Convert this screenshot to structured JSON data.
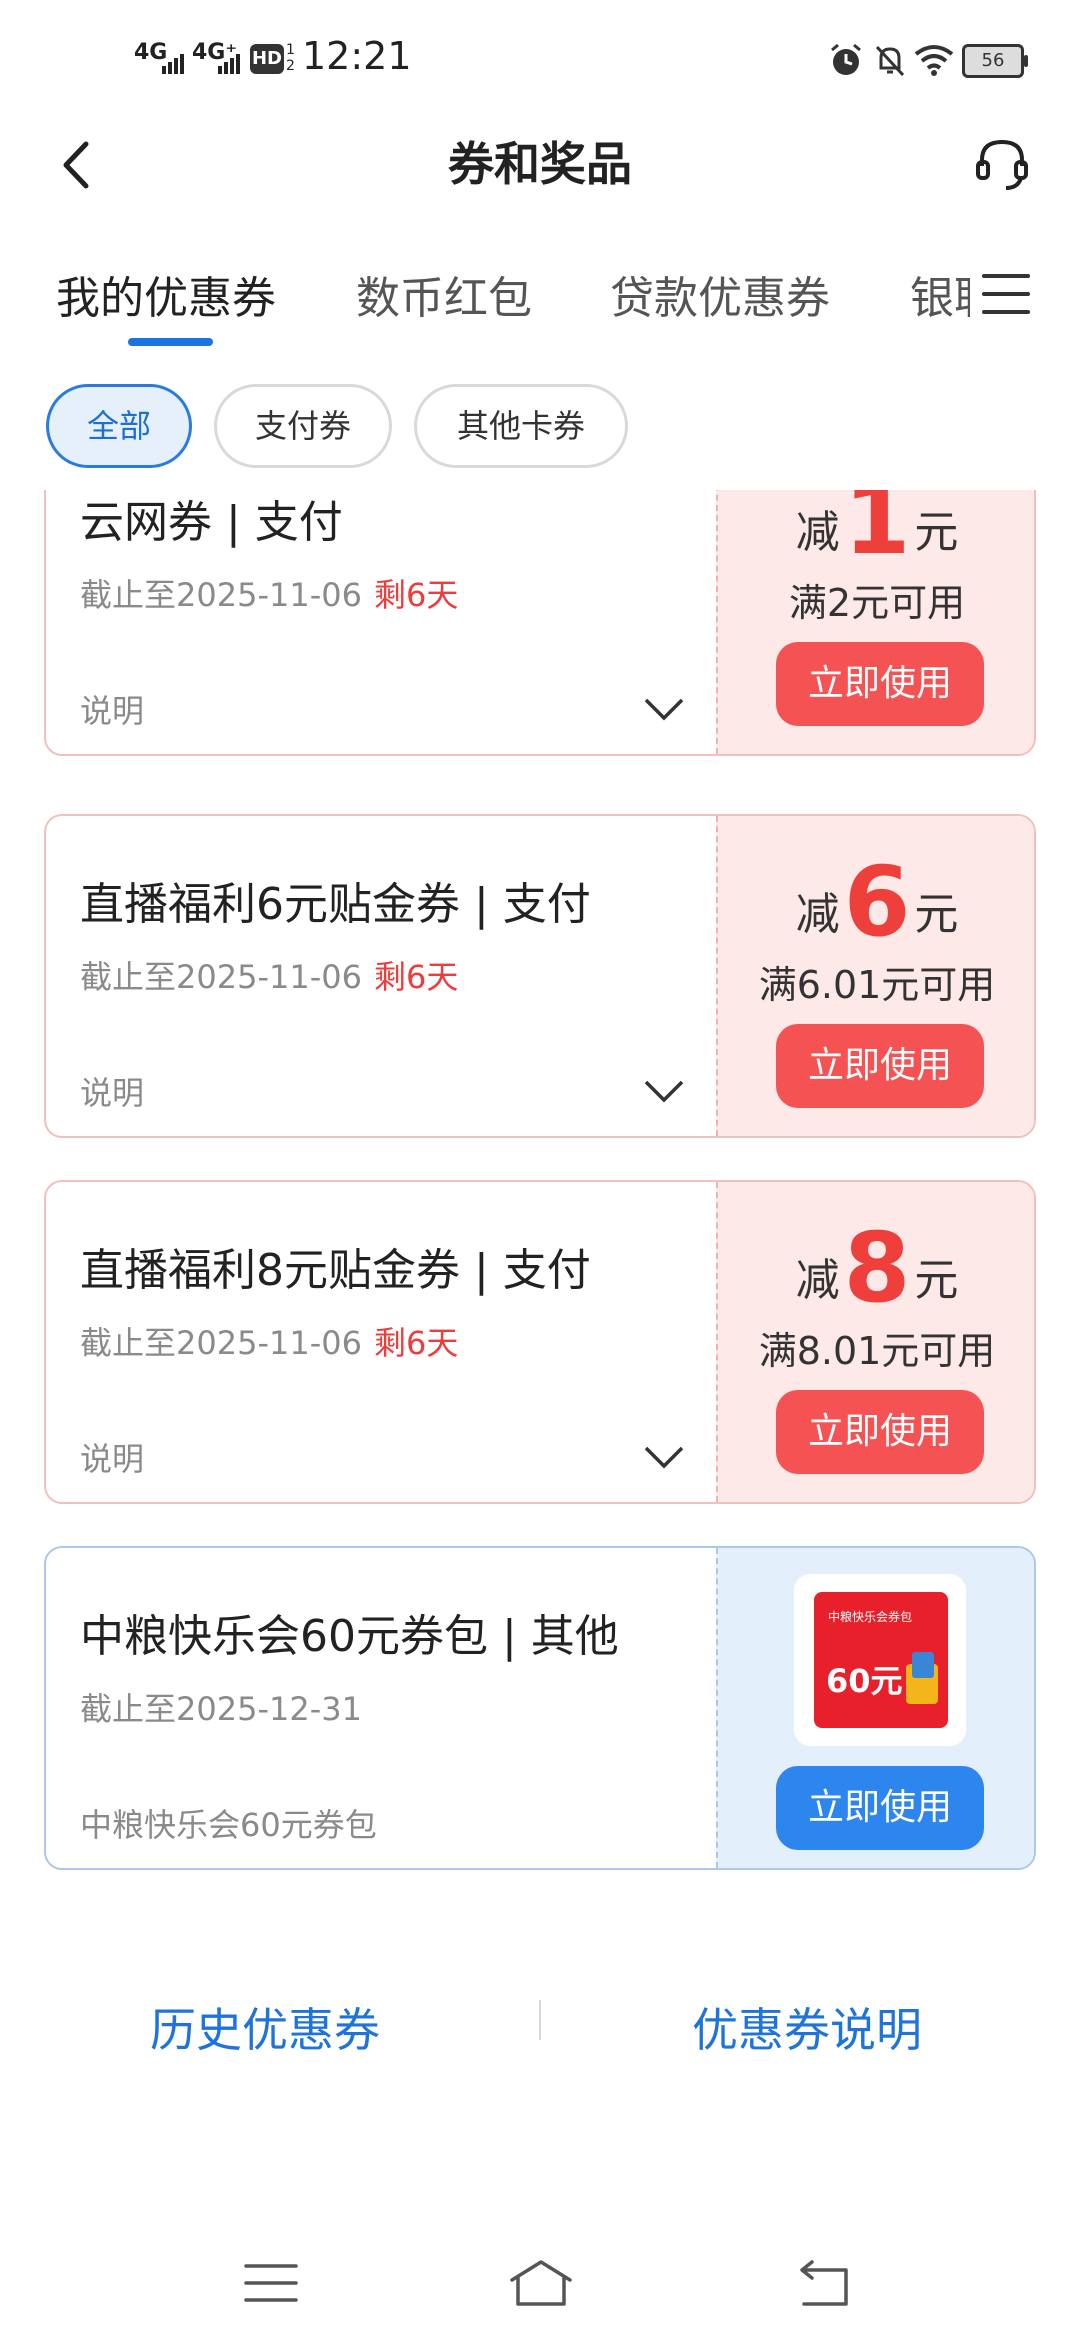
{
  "status_bar": {
    "sig1": "4G",
    "sig2": "4G⁺",
    "hd": "HD",
    "hd_sub": "1 2",
    "time": "12:21",
    "battery": "56"
  },
  "header": {
    "title": "券和奖品"
  },
  "tabs": [
    {
      "label": "我的优惠券"
    },
    {
      "label": "数币红包"
    },
    {
      "label": "贷款优惠券"
    },
    {
      "label": "银联"
    }
  ],
  "filters": [
    {
      "label": "全部"
    },
    {
      "label": "支付券"
    },
    {
      "label": "其他卡券"
    }
  ],
  "coupons": [
    {
      "name": "云网券 | 支付",
      "date": "截止至2025-11-06",
      "remaining": "剩6天",
      "note": "说明",
      "prefix": "减",
      "amount": "1",
      "suffix": "元",
      "condition": "满2元可用",
      "button": "立即使用"
    },
    {
      "name": "直播福利6元贴金券 | 支付",
      "date": "截止至2025-11-06",
      "remaining": "剩6天",
      "note": "说明",
      "prefix": "减",
      "amount": "6",
      "suffix": "元",
      "condition": "满6.01元可用",
      "button": "立即使用"
    },
    {
      "name": "直播福利8元贴金券 | 支付",
      "date": "截止至2025-11-06",
      "remaining": "剩6天",
      "note": "说明",
      "prefix": "减",
      "amount": "8",
      "suffix": "元",
      "condition": "满8.01元可用",
      "button": "立即使用"
    },
    {
      "name": "中粮快乐会60元券包 |  其他",
      "date": "截止至2025-12-31",
      "note": "中粮快乐会60元券包",
      "image_label": "中粮快乐会券包",
      "image_value": "60元",
      "button": "立即使用"
    }
  ],
  "footer": {
    "history": "历史优惠券",
    "explain": "优惠券说明"
  },
  "colors": {
    "accent_blue": "#1b74e4",
    "red": "#f55253",
    "red_bg": "#fde9e8",
    "blue_bg": "#e4effc"
  }
}
